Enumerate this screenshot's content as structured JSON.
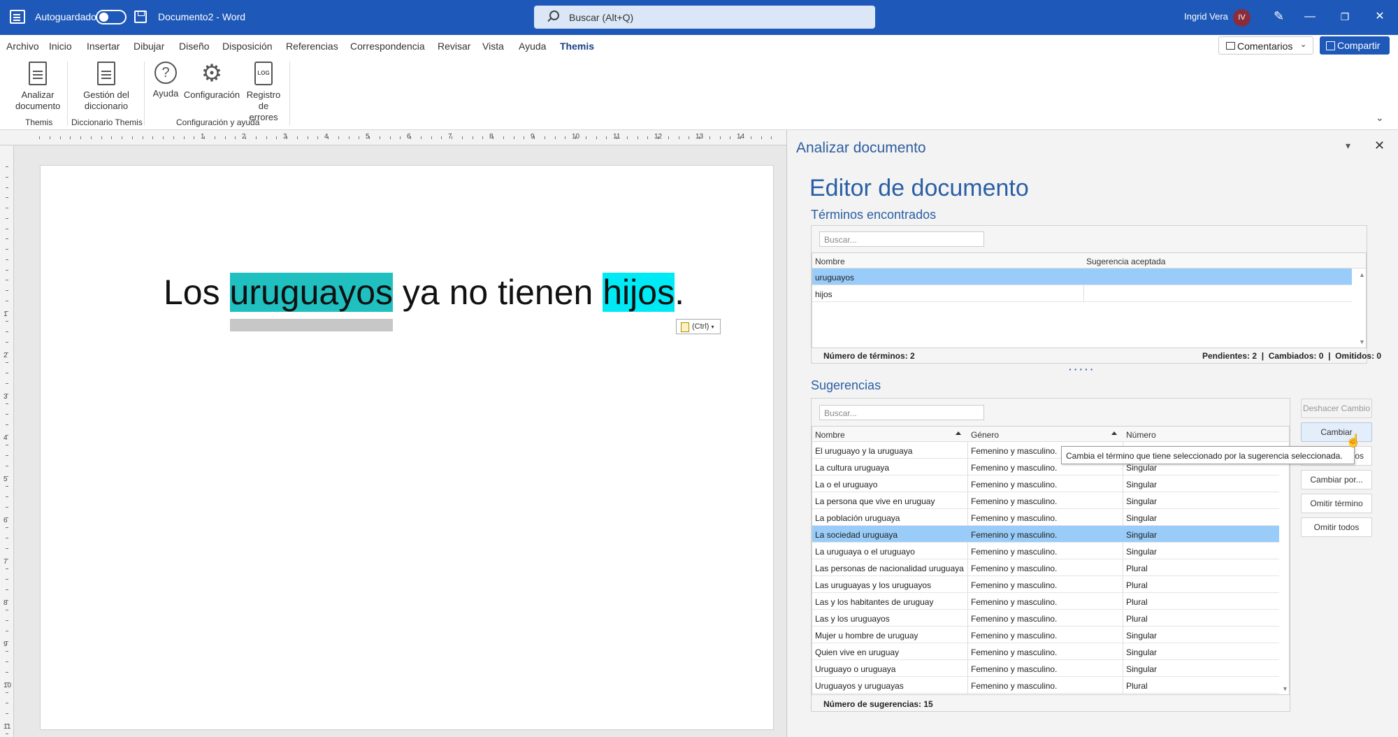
{
  "titlebar": {
    "autosave_label": "Autoguardado",
    "doc_title": "Documento2 - Word",
    "search_placeholder": "Buscar (Alt+Q)",
    "user_name": "Ingrid Vera",
    "user_initials": "IV",
    "minimize": "—",
    "restore": "❐",
    "close": "✕"
  },
  "menu": {
    "items": [
      "Archivo",
      "Inicio",
      "Insertar",
      "Dibujar",
      "Diseño",
      "Disposición",
      "Referencias",
      "Correspondencia",
      "Revisar",
      "Vista",
      "Ayuda",
      "Themis"
    ],
    "active": "Themis",
    "comments_label": "Comentarios",
    "share_label": "Compartir"
  },
  "ribbon": {
    "analizar": "Analizar documento",
    "gestion": "Gestión del diccionario",
    "ayuda": "Ayuda",
    "configuracion": "Configuración",
    "registro": "Registro de errores",
    "log_icon_text": "LOG",
    "group_themis": "Themis",
    "group_diccionario": "Diccionario Themis",
    "group_config": "Configuración y ayuda"
  },
  "ruler": {
    "numbers": [
      "1",
      "2",
      "3",
      "4",
      "5",
      "6",
      "7",
      "8",
      "9",
      "10",
      "11",
      "12",
      "13",
      "14"
    ],
    "vnumbers": [
      "1",
      "2",
      "3",
      "4",
      "5",
      "6",
      "7",
      "8",
      "9",
      "10",
      "11"
    ]
  },
  "document": {
    "before": "Los ",
    "term1": "uruguayos",
    "middle": " ya no tienen ",
    "term2": "hijos",
    "after": ".",
    "paste_label": "(Ctrl)"
  },
  "panel": {
    "title": "Analizar documento",
    "editor_title": "Editor de documento",
    "terms_section": "Términos encontrados",
    "search_placeholder": "Buscar...",
    "terms_headers": [
      "Nombre",
      "Sugerencia aceptada"
    ],
    "terms": [
      {
        "name": "uruguayos",
        "accepted": "",
        "selected": true
      },
      {
        "name": "hijos",
        "accepted": "",
        "selected": false
      }
    ],
    "terms_count": "Número de términos: 2",
    "terms_stats": "Pendientes: 2  |  Cambiados: 0  |  Omitidos: 0",
    "suggestions_section": "Sugerencias",
    "sugg_headers": [
      "Nombre",
      "Género",
      "Número"
    ],
    "suggestions": [
      {
        "name": "El uruguayo y la uruguaya",
        "genero": "Femenino y masculino.",
        "numero": "Singular"
      },
      {
        "name": "La cultura uruguaya",
        "genero": "Femenino y masculino.",
        "numero": "Singular"
      },
      {
        "name": "La o el uruguayo",
        "genero": "Femenino y masculino.",
        "numero": "Singular"
      },
      {
        "name": "La persona que vive en uruguay",
        "genero": "Femenino y masculino.",
        "numero": "Singular"
      },
      {
        "name": "La población uruguaya",
        "genero": "Femenino y masculino.",
        "numero": "Singular"
      },
      {
        "name": "La sociedad uruguaya",
        "genero": "Femenino y masculino.",
        "numero": "Singular",
        "selected": true
      },
      {
        "name": "La uruguaya o el uruguayo",
        "genero": "Femenino y masculino.",
        "numero": "Singular"
      },
      {
        "name": "Las personas de nacionalidad uruguaya",
        "genero": "Femenino y masculino.",
        "numero": "Plural"
      },
      {
        "name": "Las uruguayas y los uruguayos",
        "genero": "Femenino y masculino.",
        "numero": "Plural"
      },
      {
        "name": "Las y los habitantes de uruguay",
        "genero": "Femenino y masculino.",
        "numero": "Plural"
      },
      {
        "name": "Las y los uruguayos",
        "genero": "Femenino y masculino.",
        "numero": "Plural"
      },
      {
        "name": "Mujer u hombre de uruguay",
        "genero": "Femenino y masculino.",
        "numero": "Singular"
      },
      {
        "name": "Quien vive en uruguay",
        "genero": "Femenino y masculino.",
        "numero": "Singular"
      },
      {
        "name": "Uruguayo o uruguaya",
        "genero": "Femenino y masculino.",
        "numero": "Singular"
      },
      {
        "name": "Uruguayos y uruguayas",
        "genero": "Femenino y masculino.",
        "numero": "Plural"
      }
    ],
    "sugg_count": "Número de sugerencias: 15",
    "buttons": {
      "deshacer": "Deshacer Cambio",
      "cambiar": "Cambiar",
      "cambiar_todos": "Cambiar todos",
      "cambiar_por": "Cambiar por...",
      "omitir": "Omitir término",
      "omitir_todos": "Omitir todos"
    },
    "tooltip": "Cambia el término que tiene seleccionado por la sugerencia seleccionada."
  }
}
